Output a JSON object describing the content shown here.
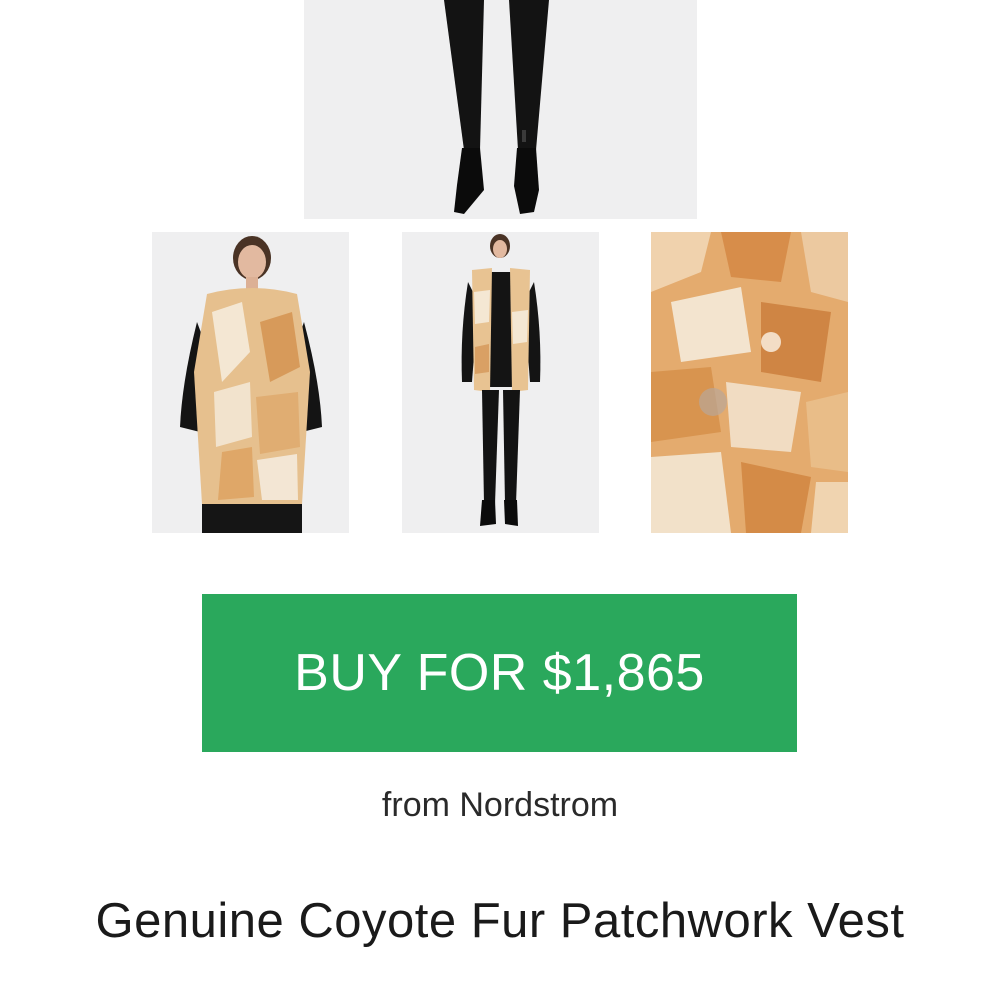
{
  "gallery": {
    "main_image": "model-legs-black-boots-photo",
    "thumbnails": [
      "model-front-vest-closeup-photo",
      "model-full-length-vest-photo",
      "fur-texture-detail-photo"
    ]
  },
  "purchase": {
    "button_label": "BUY FOR $1,865",
    "retailer_text": "from Nordstrom",
    "button_color": "#2aa85c"
  },
  "product": {
    "title": "Genuine Coyote Fur Patchwork Vest"
  }
}
